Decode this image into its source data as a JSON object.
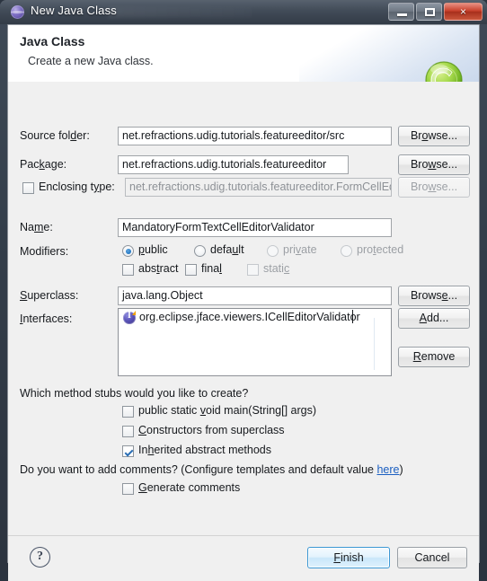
{
  "window": {
    "title": "New Java Class",
    "icon": "java-globe-icon",
    "minimize_label": "Minimize",
    "maximize_label": "Maximize",
    "close_label": "×"
  },
  "header": {
    "title": "Java Class",
    "subtitle": "Create a new Java class.",
    "icon": "java-class-green-c-icon"
  },
  "form": {
    "source_folder": {
      "label": "Source fol<u>d</u>er:",
      "value": "net.refractions.udig.tutorials.featureeditor/src",
      "browse_label": "Br<u>o</u>wse..."
    },
    "package": {
      "label": "Pac<u>k</u>age:",
      "value": "net.refractions.udig.tutorials.featureeditor",
      "browse_label": "Bro<u>w</u>se..."
    },
    "enclosing_type": {
      "label": "Enclosing t<u>y</u>pe:",
      "checked": false,
      "value": "net.refractions.udig.tutorials.featureeditor.FormCellEdito",
      "browse_label": "Bro<u>w</u>se...",
      "disabled": true
    },
    "name": {
      "label": "Na<u>m</u>e:",
      "value": "MandatoryFormTextCellEditorValidator"
    },
    "modifiers": {
      "label": "Modifiers:",
      "radios": [
        {
          "label": "<u>p</u>ublic",
          "selected": true,
          "disabled": false
        },
        {
          "label": "defa<u>u</u>lt",
          "selected": false,
          "disabled": false
        },
        {
          "label": "pri<u>v</u>ate",
          "selected": false,
          "disabled": true
        },
        {
          "label": "pro<u>t</u>ected",
          "selected": false,
          "disabled": true
        }
      ],
      "checks": [
        {
          "label": "abs<u>t</u>ract",
          "checked": false,
          "disabled": false
        },
        {
          "label": "fina<u>l</u>",
          "checked": false,
          "disabled": false
        },
        {
          "label": "stati<u>c</u>",
          "checked": false,
          "disabled": true
        }
      ]
    },
    "superclass": {
      "label": "<u>S</u>uperclass:",
      "value": "java.lang.Object",
      "browse_label": "Brows<u>e</u>..."
    },
    "interfaces": {
      "label": "<u>I</u>nterfaces:",
      "items": [
        {
          "text": "org.eclipse.jface.viewers.ICellEditorValidator",
          "icon": "interface-icon"
        }
      ],
      "add_label": "<u>A</u>dd...",
      "remove_label": "<u>R</u>emove"
    }
  },
  "stubs": {
    "question": "Which method stubs would you like to create?",
    "options": [
      {
        "label": "public static <u>v</u>oid main(String[] args)",
        "checked": false
      },
      {
        "label": "<u>C</u>onstructors from superclass",
        "checked": false
      },
      {
        "label": "In<u>h</u>erited abstract methods",
        "checked": true
      }
    ]
  },
  "comments": {
    "question_before": "Do you want to add comments? (Configure templates and default value ",
    "link": "here",
    "question_after": ")",
    "option": {
      "label": "<u>G</u>enerate comments",
      "checked": false
    }
  },
  "footer": {
    "help_label": "?",
    "finish_label": "<u>F</u>inish",
    "cancel_label": "Cancel"
  },
  "colors": {
    "accent_blue": "#2277c4",
    "link_blue": "#1b5fc1",
    "close_red": "#c8412b",
    "icon_green": "#8ccd3a",
    "frame_dark": "#333d49"
  }
}
